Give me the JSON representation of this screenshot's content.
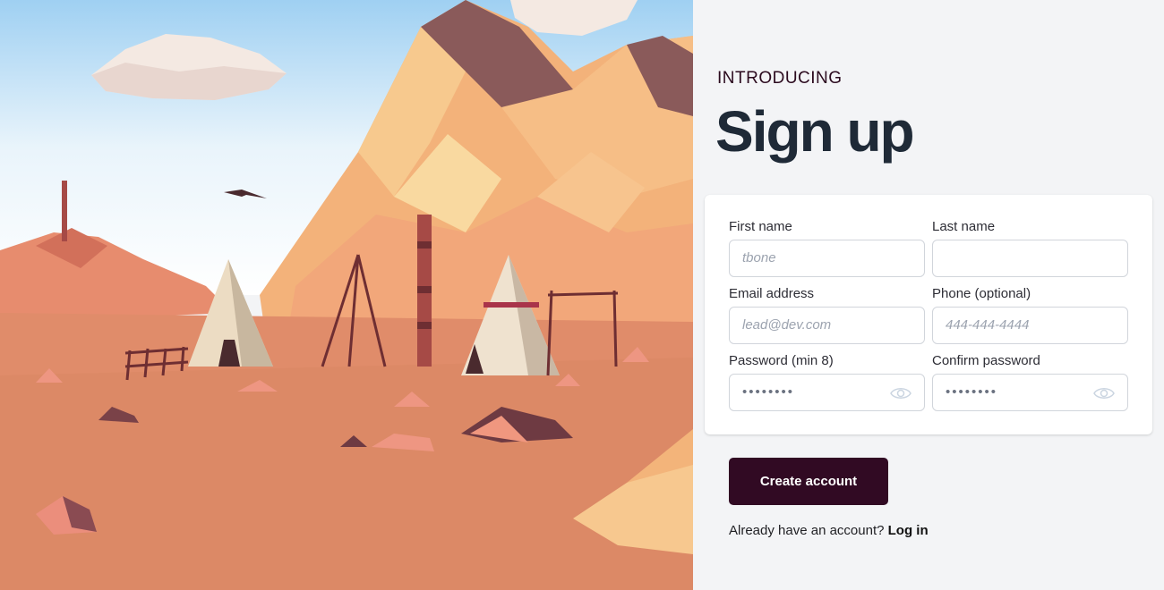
{
  "header": {
    "eyebrow": "INTRODUCING",
    "title": "Sign up"
  },
  "form": {
    "first_name": {
      "label": "First name",
      "placeholder": "tbone"
    },
    "last_name": {
      "label": "Last name",
      "placeholder": ""
    },
    "email": {
      "label": "Email address",
      "placeholder": "lead@dev.com"
    },
    "phone": {
      "label": "Phone (optional)",
      "placeholder": "444-444-4444"
    },
    "password": {
      "label": "Password (min 8)",
      "value_masked": "••••••••"
    },
    "confirm_password": {
      "label": "Confirm password",
      "value_masked": "••••••••"
    }
  },
  "actions": {
    "submit_label": "Create account",
    "login_prompt": "Already have an account?",
    "login_link": "Log in"
  },
  "colors": {
    "accent": "#310a23",
    "title": "#1f2a37",
    "panel_bg": "#f3f4f6"
  },
  "icons": {
    "password_toggle": "eye-icon"
  }
}
